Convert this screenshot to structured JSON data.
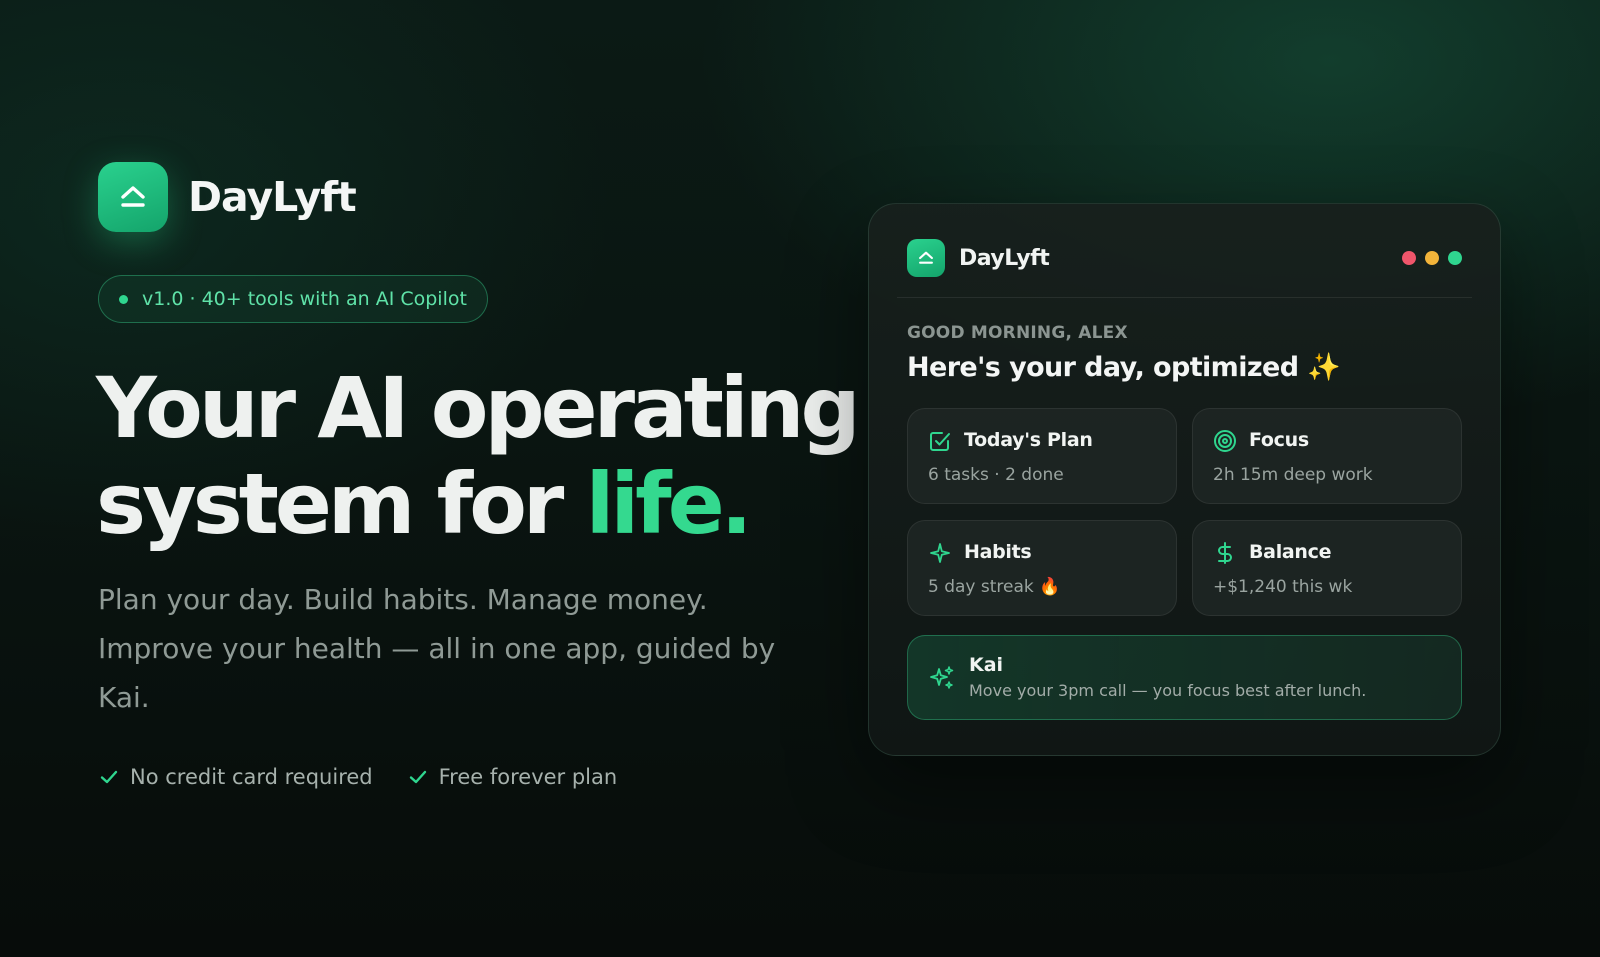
{
  "brand": {
    "name": "DayLyft",
    "logo_icon": "chevron-up-bar-icon",
    "accent_color": "#2fd68f"
  },
  "badge": {
    "text": "v1.0 · 40+ tools with an AI Copilot"
  },
  "hero": {
    "headline_line1": "Your AI operating",
    "headline_line2_prefix": "system for ",
    "headline_line2_accent": "life.",
    "subtitle": "Plan your day. Build habits. Manage money. Improve your health — all in one app, guided by Kai."
  },
  "perks": [
    {
      "label": "No credit card required",
      "icon": "check-icon"
    },
    {
      "label": "Free forever plan",
      "icon": "check-icon"
    }
  ],
  "app": {
    "name": "DayLyft",
    "window_dots": [
      "#f0566b",
      "#f2b43a",
      "#2fd68f"
    ],
    "greeting": "GOOD MORNING, ALEX",
    "title": "Here's your day, optimized",
    "title_emoji": "✨",
    "tiles": [
      {
        "title": "Today's Plan",
        "subtitle": "6 tasks · 2 done",
        "icon": "checkbox-icon"
      },
      {
        "title": "Focus",
        "subtitle": "2h 15m deep work",
        "icon": "target-icon"
      },
      {
        "title": "Habits",
        "subtitle": "5 day streak 🔥",
        "icon": "sparkle-icon"
      },
      {
        "title": "Balance",
        "subtitle": "+$1,240 this wk",
        "icon": "dollar-icon"
      }
    ],
    "assistant": {
      "name": "Kai",
      "message": "Move your 3pm call — you focus best after lunch.",
      "icon": "sparkles-icon"
    }
  }
}
